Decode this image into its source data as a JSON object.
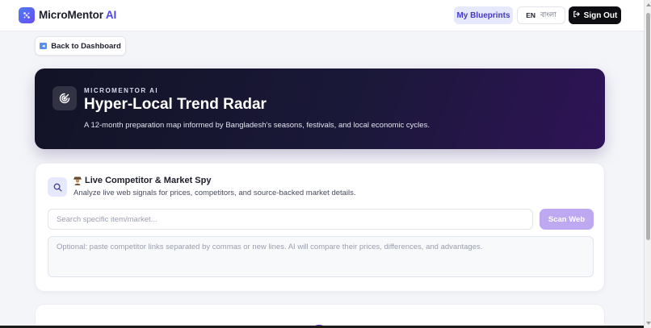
{
  "header": {
    "brand_name": "MicroMentor",
    "brand_suffix": "AI",
    "blueprints_label": "My Blueprints",
    "lang_en": "EN",
    "lang_bn": "বাংলা",
    "signout_label": "Sign Out"
  },
  "nav": {
    "back_label": "Back to Dashboard"
  },
  "hero": {
    "eyebrow": "MICROMENTOR AI",
    "title": "Hyper-Local Trend Radar",
    "subtitle": "A 12-month preparation map informed by Bangladesh's seasons, festivals, and local economic cycles."
  },
  "spy": {
    "title": "Live Competitor & Market Spy",
    "subtitle": "Analyze live web signals for prices, competitors, and source-backed market details.",
    "search_placeholder": "Search specific item/market...",
    "scan_label": "Scan Web",
    "links_placeholder": "Optional: paste competitor links separated by commas or new lines. AI will compare their prices, differences, and advantages."
  },
  "colors": {
    "accent": "#4f46e5",
    "hero_dark": "#121326",
    "hero_purple": "#2f1357",
    "scan_button": "#bfa8f2"
  },
  "icons": {
    "logo": "sparkle-icon",
    "signout": "sign-out-icon",
    "back": "back-arrow-icon",
    "hero": "radar-icon",
    "spy": "search-icon",
    "spy_emoji": "detective-icon",
    "next_card": "signal-icon"
  }
}
